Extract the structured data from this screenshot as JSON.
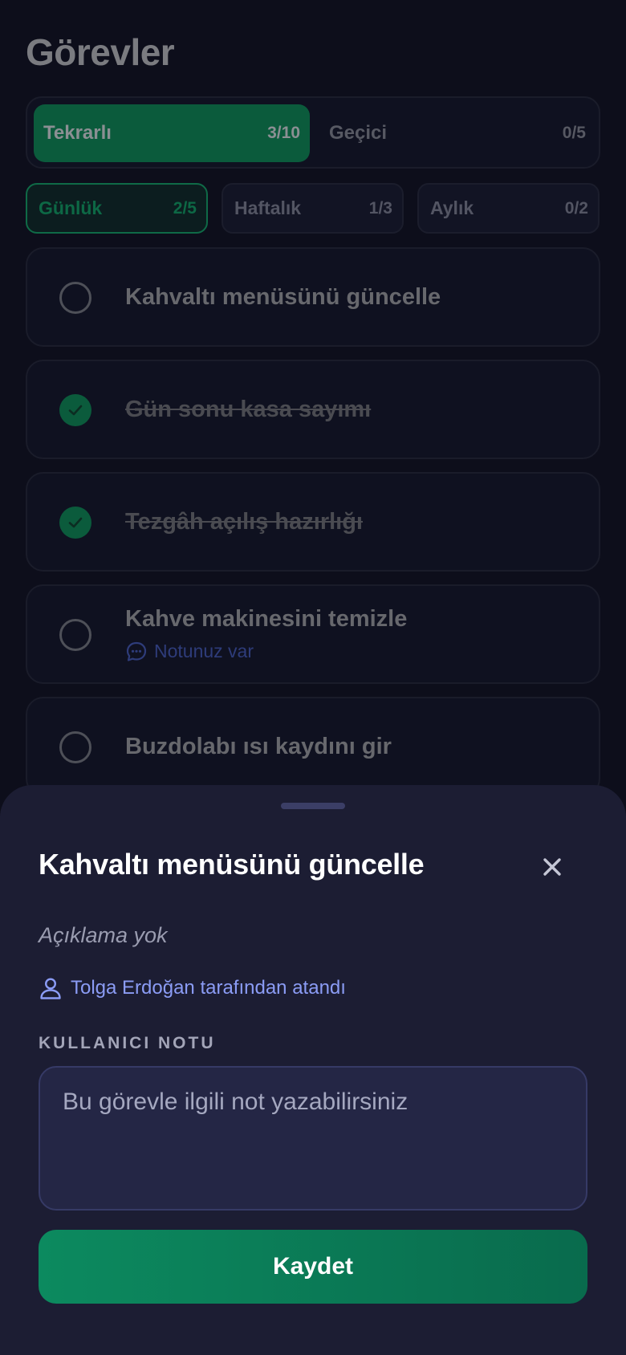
{
  "page": {
    "title": "Görevler"
  },
  "segment_tabs": [
    {
      "label": "Tekrarlı",
      "count": "3/10",
      "active": true
    },
    {
      "label": "Geçici",
      "count": "0/5",
      "active": false
    }
  ],
  "period_tabs": [
    {
      "label": "Günlük",
      "count": "2/5",
      "active": true
    },
    {
      "label": "Haftalık",
      "count": "1/3",
      "active": false
    },
    {
      "label": "Aylık",
      "count": "0/2",
      "active": false
    }
  ],
  "tasks": [
    {
      "name": "Kahvaltı menüsünü güncelle",
      "done": false
    },
    {
      "name": "Gün sonu kasa sayımı",
      "done": true
    },
    {
      "name": "Tezgâh açılış hazırlığı",
      "done": true
    },
    {
      "name": "Kahve makinesini temizle",
      "done": false,
      "note_label": "Notunuz var"
    },
    {
      "name": "Buzdolabı ısı kaydını gir",
      "done": false
    }
  ],
  "sheet": {
    "title": "Kahvaltı menüsünü güncelle",
    "description": "Açıklama yok",
    "assigned_by": "Tolga Erdoğan tarafından atandı",
    "note_section_label": "KULLANICI NOTU",
    "note_placeholder": "Bu görevle ilgili not yazabilirsiniz",
    "save_label": "Kaydet"
  },
  "colors": {
    "background": "#0d0e1b",
    "accent": "#0c8a5f",
    "sheet": "#1c1d33",
    "link": "#8b9cf5"
  },
  "icons": {
    "check": "check-icon",
    "note": "chat-bubble-icon",
    "user": "user-icon",
    "close": "close-icon"
  }
}
